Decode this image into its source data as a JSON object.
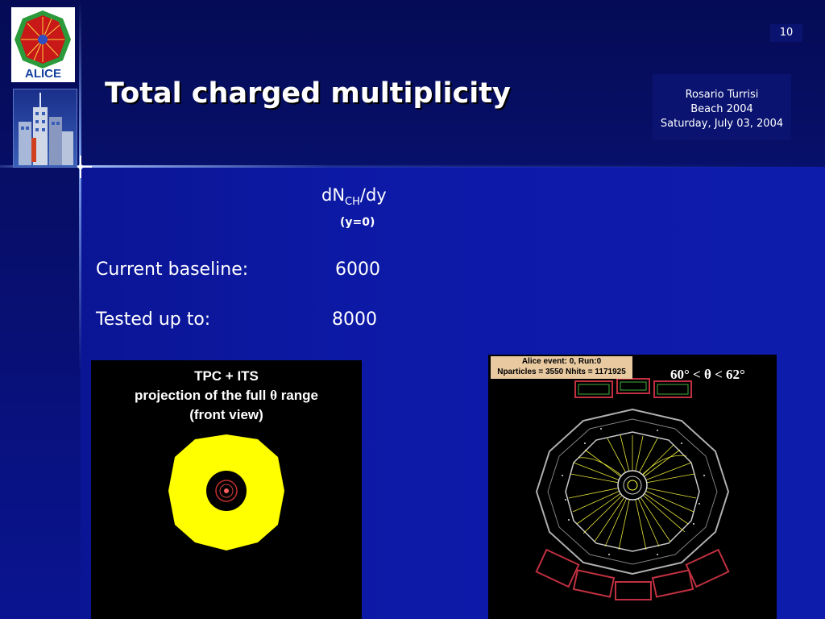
{
  "slide": {
    "page_number": "10",
    "title": "Total charged multiplicity"
  },
  "author": {
    "name": "Rosario Turrisi",
    "event": "Beach 2004",
    "date": "Saturday, July 03, 2004"
  },
  "logo": {
    "text": "ALICE"
  },
  "quantity": {
    "main": "dN",
    "subscript": "CH",
    "suffix": "/dy",
    "condition": "(y=0)"
  },
  "rows": [
    {
      "label": "Current baseline:",
      "value": "6000"
    },
    {
      "label": "Tested up to:",
      "value": "8000"
    }
  ],
  "left_panel": {
    "line1": "TPC + ITS",
    "line2_pre": "projection of the full ",
    "line2_symbol": "θ",
    "line2_post": " range",
    "line3": "(front view)"
  },
  "right_panel": {
    "event_line1": "Alice event: 0, Run:0",
    "event_line2": "Nparticles = 3550  Nhits = 1171925",
    "theta_range": "60° <  θ < 62°"
  },
  "colors": {
    "background": "#0a0f7a",
    "detector_yellow": "#ffff00",
    "label_bg": "#e8c9a0"
  }
}
